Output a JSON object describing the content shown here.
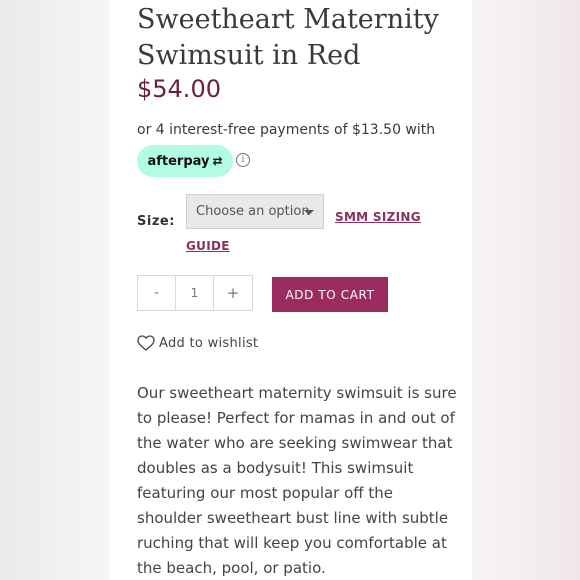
{
  "product": {
    "title": "Sweetheart Maternity Swimsuit in Red",
    "price": "$54.00"
  },
  "payment": {
    "installments_text": "or 4 interest-free payments of $13.50 with",
    "provider_label": "afterpay",
    "info_glyph": "ⓘ"
  },
  "options": {
    "size_label": "Size:",
    "select_value": "Choose an option",
    "sizing_guide_link": "SMM SIZING GUIDE"
  },
  "cart": {
    "minus_label": "-",
    "quantity": "1",
    "plus_label": "+",
    "add_to_cart_label": "ADD TO CART"
  },
  "wishlist": {
    "label": "Add to wishlist"
  },
  "description": {
    "text": "Our sweetheart maternity swimsuit is sure to please! Perfect for mamas in and out of the water who are seeking swimwear that doubles as a bodysuit! This swimsuit featuring our most popular off the shoulder sweetheart bust line with subtle ruching that will keep you comfortable at the beach, pool, or patio."
  },
  "colors": {
    "price": "#6b1f3a",
    "accent": "#9c2c5f",
    "afterpay_bg": "#b2fce4"
  },
  "icons": {
    "wishlist": "heart-icon",
    "dropdown": "chevron-down-icon",
    "info": "info-icon"
  }
}
